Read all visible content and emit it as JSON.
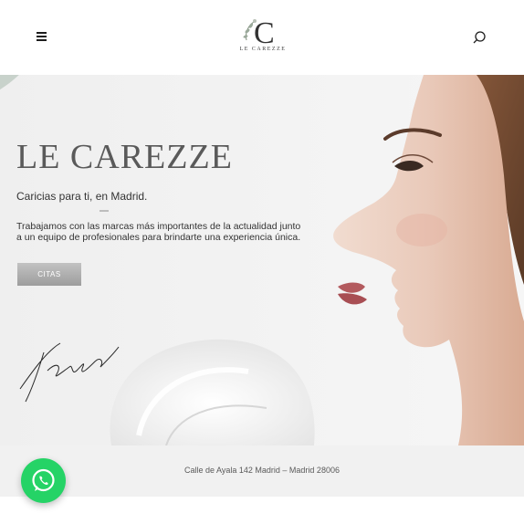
{
  "header": {
    "menu_icon": "hamburger-menu-icon",
    "logo_text": "LE CAREZZE",
    "search_icon": "search-icon"
  },
  "hero": {
    "title": "LE CAREZZE",
    "subtitle": "Caricias para ti, en Madrid.",
    "description": "Trabajamos con las marcas más importantes de la actualidad junto a un equipo de profesionales para brindarte una experiencia única.",
    "cta_label": "CITAS",
    "signature": "Fiorella Contepelle"
  },
  "footer": {
    "address": "Calle de Ayala 142 Madrid – Madrid 28006"
  },
  "floating": {
    "whatsapp_icon": "whatsapp-icon",
    "accent": "#25d366"
  }
}
